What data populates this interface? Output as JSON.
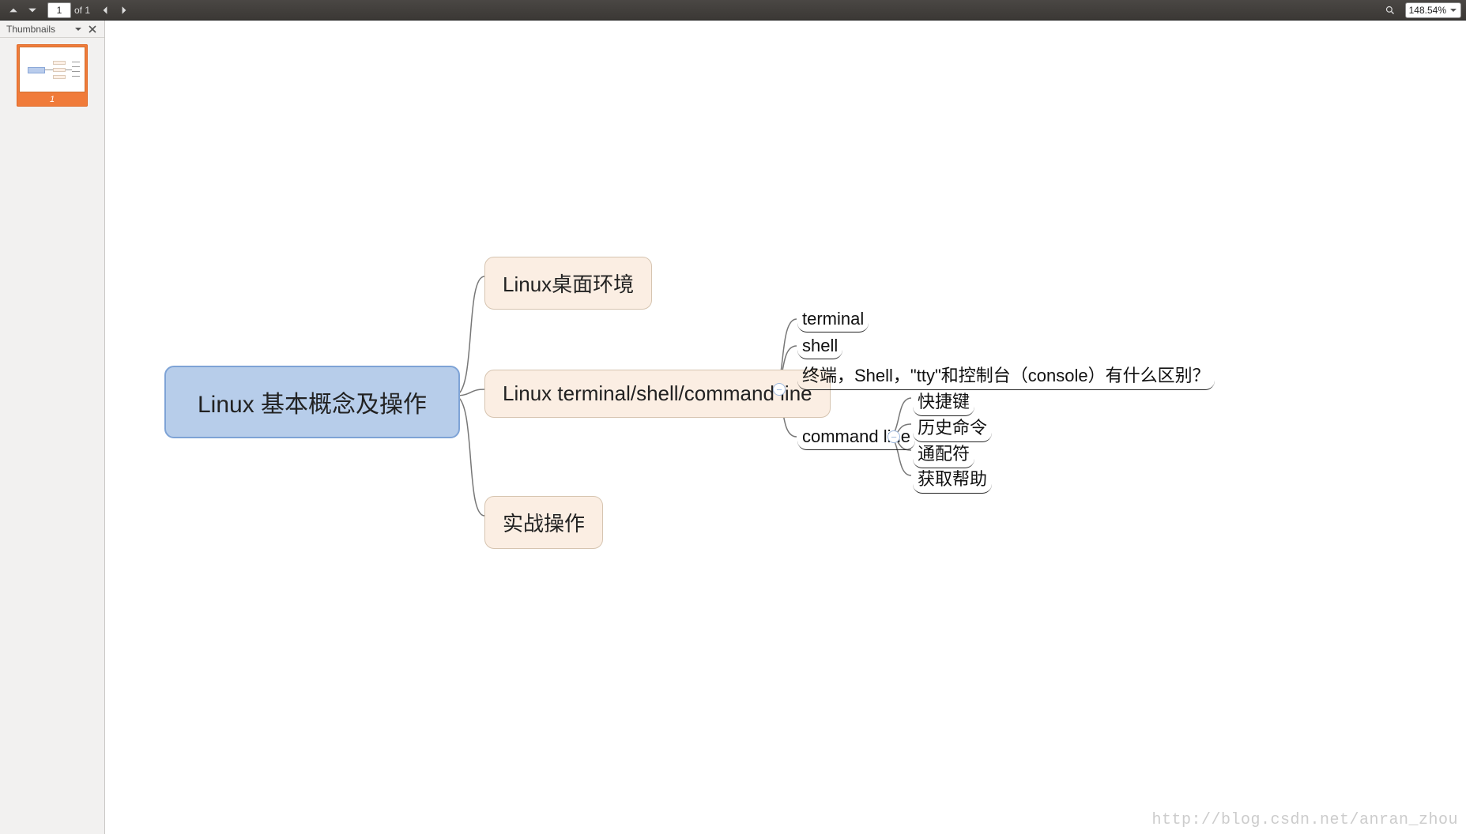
{
  "toolbar": {
    "page_input": "1",
    "page_total": "of 1",
    "zoom": "148.54%"
  },
  "sidebar": {
    "header": "Thumbnails",
    "thumb_num": "1"
  },
  "mindmap": {
    "root": "Linux 基本概念及操作",
    "children": [
      {
        "label": "Linux桌面环境"
      },
      {
        "label": "Linux terminal/shell/command line",
        "leaves": [
          {
            "label": "terminal"
          },
          {
            "label": "shell"
          },
          {
            "label": "终端，Shell，\"tty\"和控制台（console）有什么区别？"
          },
          {
            "label": "command line",
            "leaves": [
              {
                "label": "快捷键"
              },
              {
                "label": "历史命令"
              },
              {
                "label": "通配符"
              },
              {
                "label": "获取帮助"
              }
            ]
          }
        ]
      },
      {
        "label": "实战操作"
      }
    ]
  },
  "watermark": "http://blog.csdn.net/anran_zhou"
}
